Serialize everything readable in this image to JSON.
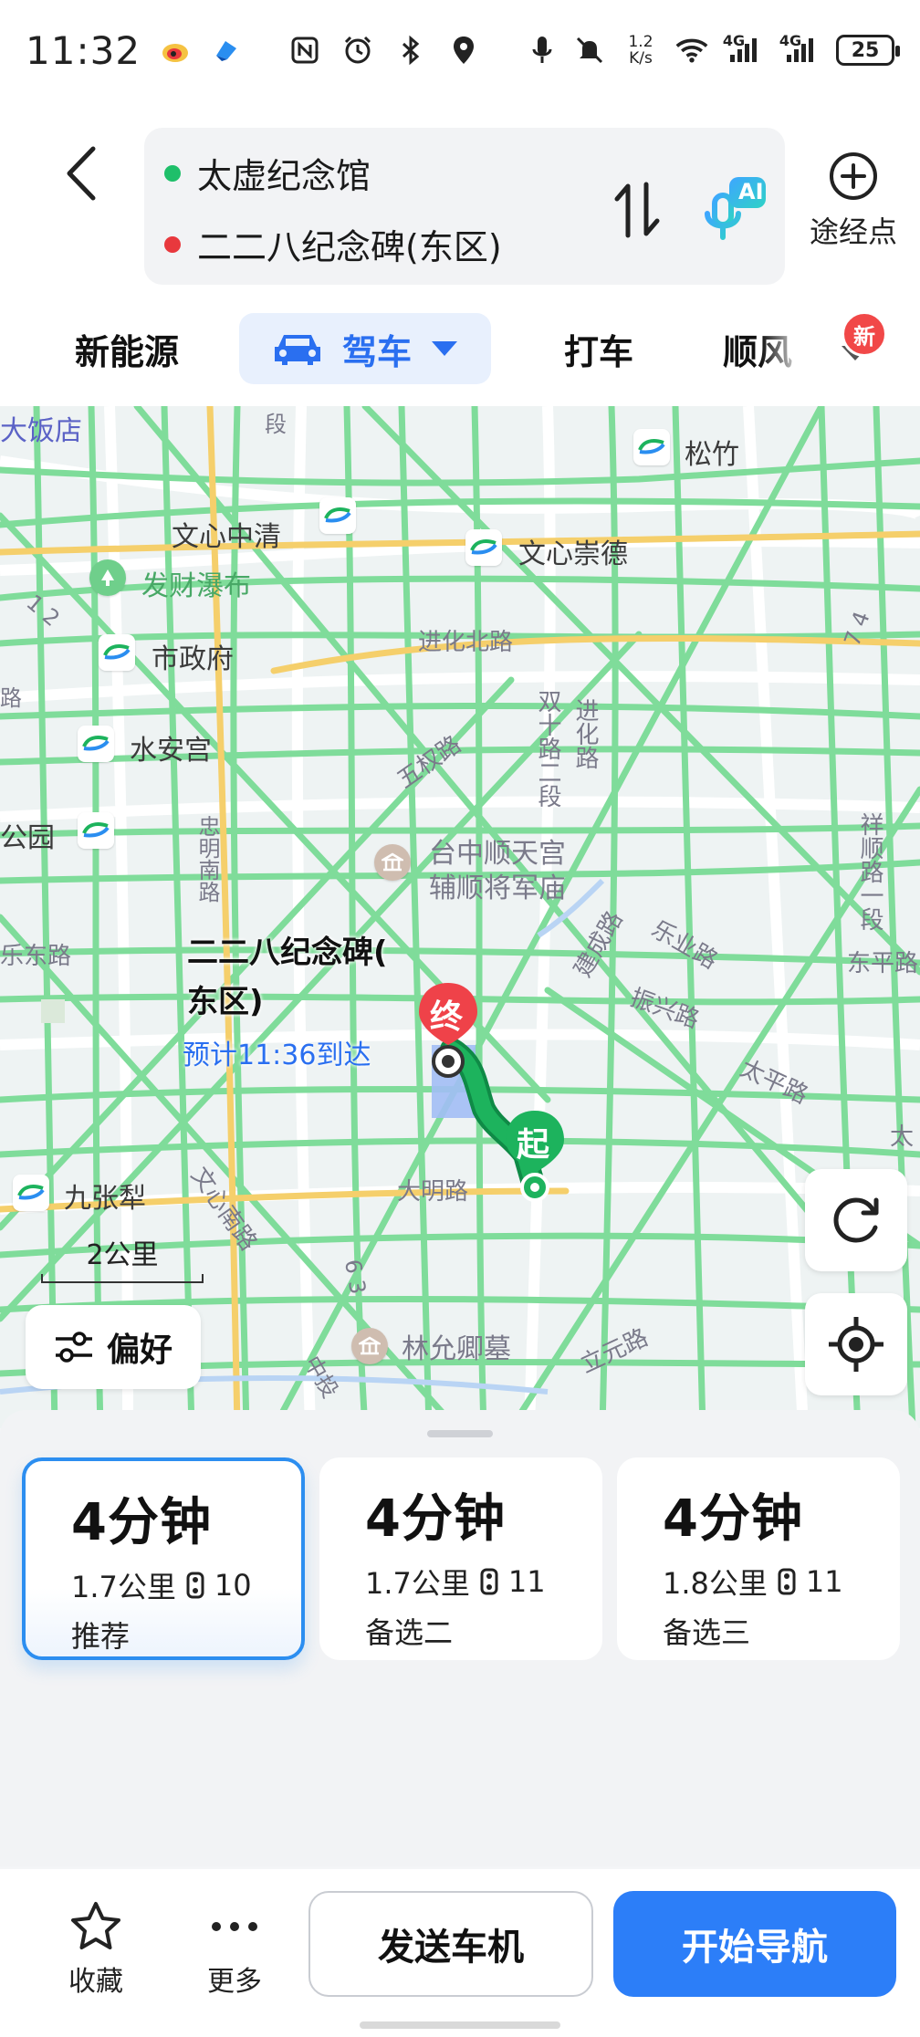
{
  "status_bar": {
    "time": "11:32",
    "net_speed_value": "1.2",
    "net_speed_unit": "K/s",
    "signal_1": "4G",
    "signal_2": "4G",
    "battery": "25",
    "icons": [
      "weibo-icon",
      "app-icon",
      "nfc-icon",
      "alarm-icon",
      "bluetooth-icon",
      "location-icon",
      "mic-icon",
      "mute-icon",
      "wifi-icon",
      "signal-icon",
      "battery-icon"
    ]
  },
  "route": {
    "start": "太虚纪念馆",
    "end": "二二八纪念碑(东区)",
    "start_color": "#1fbf6a",
    "end_color": "#e8383d",
    "ai_label": "AI",
    "waypoint_label": "途经点"
  },
  "modes": {
    "new_energy": "新能源",
    "drive": "驾车",
    "taxi": "打车",
    "ride": "顺风",
    "new_badge": "新",
    "active": "驾车"
  },
  "map": {
    "labels": {
      "fanfian": "大饭店",
      "songzhu": "松竹",
      "wenxin_zhongqing": "文心中清",
      "wenxin_chongde": "文心崇德",
      "facai": "发财瀑布",
      "shizhengfu": "市政府",
      "jinhua_north": "进化北路",
      "shuianguan": "水安宫",
      "wuquan": "五权路",
      "gongyuan": "公园",
      "zhongming": "忠明南路",
      "shuangshi": "双十路二段",
      "jinhua": "进化路",
      "shunfu": "祥顺路一段",
      "temple_1": "台中顺天宫",
      "temple_2": "辅顺将军庙",
      "jiancheng": "建成路",
      "leye": "乐业路",
      "dongping": "东平路",
      "zhenxing": "振兴路",
      "taiping": "太平路",
      "dongqu": "乐东路",
      "jiuzhangli": "九张犁",
      "wenxin_south": "文心南路",
      "daming": "大明路",
      "lin": "林允卿墓",
      "liyuan": "立元路",
      "zhongtou": "中投",
      "num_12": "1 2",
      "num_74": "7 4",
      "num_63": "6 3",
      "duan": "段",
      "lu": "路",
      "taipingfar": "太"
    },
    "destination_title_line1": "二二八纪念碑(",
    "destination_title_line2": "东区)",
    "eta": "预计11:36到达",
    "end_marker": "终",
    "start_marker": "起",
    "scale": "2公里",
    "preference": "偏好"
  },
  "routes": [
    {
      "duration": "4分钟",
      "distance": "1.7公里",
      "lights": "10",
      "tag": "推荐",
      "selected": true
    },
    {
      "duration": "4分钟",
      "distance": "1.7公里",
      "lights": "11",
      "tag": "备选二",
      "selected": false
    },
    {
      "duration": "4分钟",
      "distance": "1.8公里",
      "lights": "11",
      "tag": "备选三",
      "selected": false
    }
  ],
  "actions": {
    "favorite": "收藏",
    "more": "更多",
    "send_to_car": "发送车机",
    "start_nav": "开始导航"
  },
  "colors": {
    "accent": "#2c7ef8",
    "route_green": "#1db35d",
    "road_green": "#7fdc9a",
    "road_yellow": "#f5cf6b"
  }
}
